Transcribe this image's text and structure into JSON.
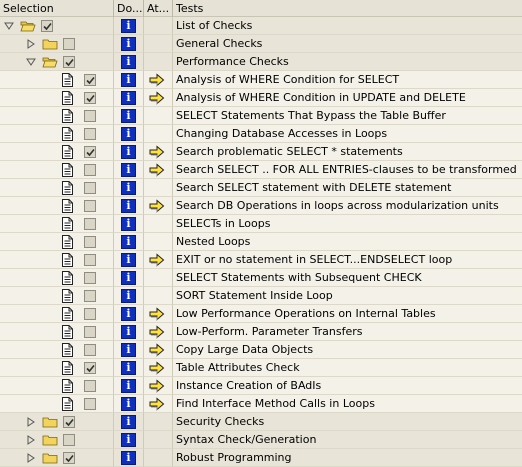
{
  "columns": {
    "selection": "Selection",
    "doc": "Do...",
    "attr": "At...",
    "tests": "Tests"
  },
  "rows": [
    {
      "kind": "group",
      "level": 0,
      "expanded": true,
      "checked": true,
      "label": "List of Checks"
    },
    {
      "kind": "group",
      "level": 1,
      "expanded": false,
      "checked": false,
      "label": "General Checks"
    },
    {
      "kind": "group",
      "level": 1,
      "expanded": true,
      "checked": true,
      "label": "Performance Checks"
    },
    {
      "kind": "check",
      "checked": true,
      "attr": true,
      "label": "Analysis of WHERE Condition for SELECT"
    },
    {
      "kind": "check",
      "checked": true,
      "attr": true,
      "label": "Analysis of WHERE Condition in UPDATE and DELETE"
    },
    {
      "kind": "check",
      "checked": false,
      "attr": false,
      "label": "SELECT Statements That Bypass the Table Buffer"
    },
    {
      "kind": "check",
      "checked": false,
      "attr": false,
      "label": "Changing Database Accesses in Loops"
    },
    {
      "kind": "check",
      "checked": true,
      "attr": true,
      "label": "Search problematic SELECT * statements"
    },
    {
      "kind": "check",
      "checked": false,
      "attr": true,
      "label": "Search SELECT .. FOR ALL ENTRIES-clauses to be transformed"
    },
    {
      "kind": "check",
      "checked": false,
      "attr": false,
      "label": "Search SELECT statement with DELETE statement"
    },
    {
      "kind": "check",
      "checked": false,
      "attr": true,
      "label": "Search DB Operations in loops across modularization units"
    },
    {
      "kind": "check",
      "checked": false,
      "attr": false,
      "label": "SELECTs in Loops"
    },
    {
      "kind": "check",
      "checked": false,
      "attr": false,
      "label": "Nested Loops"
    },
    {
      "kind": "check",
      "checked": false,
      "attr": true,
      "label": "EXIT or no statement in SELECT...ENDSELECT loop"
    },
    {
      "kind": "check",
      "checked": false,
      "attr": false,
      "label": "SELECT Statements with Subsequent CHECK"
    },
    {
      "kind": "check",
      "checked": false,
      "attr": false,
      "label": "SORT Statement Inside Loop"
    },
    {
      "kind": "check",
      "checked": false,
      "attr": true,
      "label": "Low Performance Operations on Internal Tables"
    },
    {
      "kind": "check",
      "checked": false,
      "attr": true,
      "label": "Low-Perform. Parameter Transfers"
    },
    {
      "kind": "check",
      "checked": false,
      "attr": true,
      "label": "Copy Large Data Objects"
    },
    {
      "kind": "check",
      "checked": true,
      "attr": true,
      "label": "Table Attributes Check"
    },
    {
      "kind": "check",
      "checked": false,
      "attr": true,
      "label": "Instance Creation of BAdIs"
    },
    {
      "kind": "check",
      "checked": false,
      "attr": true,
      "label": "Find Interface Method Calls in Loops"
    },
    {
      "kind": "group",
      "level": 1,
      "expanded": false,
      "checked": true,
      "label": "Security Checks"
    },
    {
      "kind": "group",
      "level": 1,
      "expanded": false,
      "checked": false,
      "label": "Syntax Check/Generation"
    },
    {
      "kind": "group",
      "level": 1,
      "expanded": false,
      "checked": true,
      "label": "Robust Programming"
    }
  ]
}
